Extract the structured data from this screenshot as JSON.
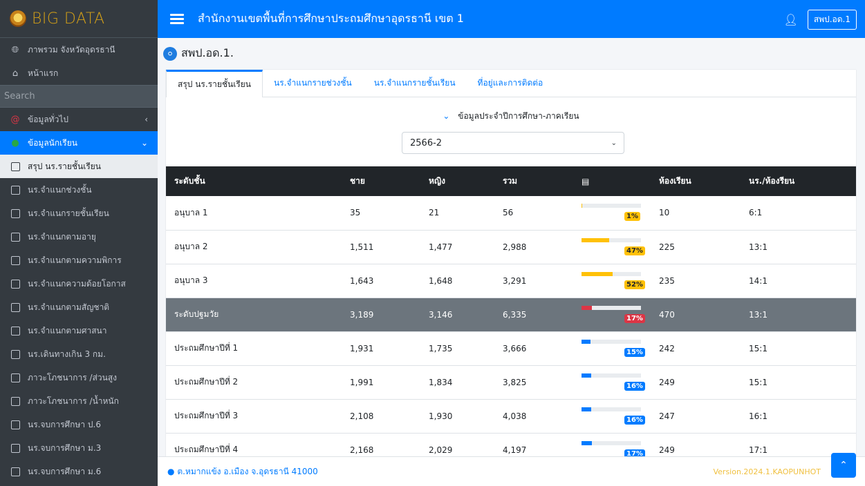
{
  "brand": {
    "name": "BIG DATA"
  },
  "sidebar": {
    "top_items": [
      {
        "icon": "globe-icon",
        "label": "ภาพรวม จังหวัดอุดรธานี"
      },
      {
        "icon": "home-icon",
        "label": "หน้าแรก"
      }
    ],
    "search_placeholder": "Search",
    "groups": [
      {
        "icon": "at-icon",
        "label": "ข้อมูลทั่วไป"
      },
      {
        "icon": "circle-icon",
        "label": "ข้อมูลนักเรียน"
      }
    ],
    "sub_items": [
      "สรุป นร.รายชั้นเรียน",
      "นร.จำแนกช่วงชั้น",
      "นร.จำแนกรายชั้นเรียน",
      "นร.จำแนกตามอายุ",
      "นร.จำแนกตามความพิการ",
      "นร.จำแนกความด้อยโอกาส",
      "นร.จำแนกตามสัญชาติ",
      "นร.จำแนกตามศาสนา",
      "นร.เดินทางเกิน 3 กม.",
      "ภาวะโภชนาการ /ส่วนสูง",
      "ภาวะโภชนาการ /น้ำหนัก",
      "นร.จบการศึกษา ป.6",
      "นร.จบการศึกษา ม.3",
      "นร.จบการศึกษา ม.6"
    ]
  },
  "topbar": {
    "title": "สำนักงานเขตพื้นที่การศึกษาประถมศึกษาอุดรธานี เขต 1",
    "button": "สพป.อด.1"
  },
  "page": {
    "title": "สพป.อด.1."
  },
  "tabs": [
    "สรุป นร.รายชั้นเรียน",
    "นร.จำแนกรายช่วงชั้น",
    "นร.จำแนกรายชั้นเรียน",
    "ที่อยู่และการติดต่อ"
  ],
  "filter": {
    "label": "ข้อมูลประจำปีการศึกษา-ภาคเรียน",
    "selected": "2566-2"
  },
  "table": {
    "headers": [
      "ระดับชั้น",
      "ชาย",
      "หญิง",
      "รวม",
      "",
      "ห้องเรียน",
      "นร./ห้องรียน"
    ],
    "rows": [
      {
        "level": "อนุบาล 1",
        "male": "35",
        "female": "21",
        "total": "56",
        "pct": 1,
        "pct_label": "1%",
        "color": "yellow",
        "rooms": "10",
        "ratio": "6:1",
        "summary": false
      },
      {
        "level": "อนุบาล 2",
        "male": "1,511",
        "female": "1,477",
        "total": "2,988",
        "pct": 47,
        "pct_label": "47%",
        "color": "yellow",
        "rooms": "225",
        "ratio": "13:1",
        "summary": false
      },
      {
        "level": "อนุบาล 3",
        "male": "1,643",
        "female": "1,648",
        "total": "3,291",
        "pct": 52,
        "pct_label": "52%",
        "color": "yellow",
        "rooms": "235",
        "ratio": "14:1",
        "summary": false
      },
      {
        "level": "ระดับปฐมวัย",
        "male": "3,189",
        "female": "3,146",
        "total": "6,335",
        "pct": 17,
        "pct_label": "17%",
        "color": "red",
        "rooms": "470",
        "ratio": "13:1",
        "summary": true
      },
      {
        "level": "ประถมศึกษาปีที่ 1",
        "male": "1,931",
        "female": "1,735",
        "total": "3,666",
        "pct": 15,
        "pct_label": "15%",
        "color": "blue",
        "rooms": "242",
        "ratio": "15:1",
        "summary": false
      },
      {
        "level": "ประถมศึกษาปีที่ 2",
        "male": "1,991",
        "female": "1,834",
        "total": "3,825",
        "pct": 16,
        "pct_label": "16%",
        "color": "blue",
        "rooms": "249",
        "ratio": "15:1",
        "summary": false
      },
      {
        "level": "ประถมศึกษาปีที่ 3",
        "male": "2,108",
        "female": "1,930",
        "total": "4,038",
        "pct": 16,
        "pct_label": "16%",
        "color": "blue",
        "rooms": "247",
        "ratio": "16:1",
        "summary": false
      },
      {
        "level": "ประถมศึกษาปีที่ 4",
        "male": "2,168",
        "female": "2,029",
        "total": "4,197",
        "pct": 17,
        "pct_label": "17%",
        "color": "blue",
        "rooms": "249",
        "ratio": "17:1",
        "summary": false
      }
    ]
  },
  "footer": {
    "address": "ต.หมากแข้ง อ.เมือง จ.อุดรธานี 41000",
    "version": "Version.2024.1.KAOPUNHOT"
  },
  "colors": {
    "primary": "#007bff",
    "sidebar": "#343a40",
    "yellow": "#ffc107",
    "red": "#dc3545",
    "blue": "#007bff"
  }
}
